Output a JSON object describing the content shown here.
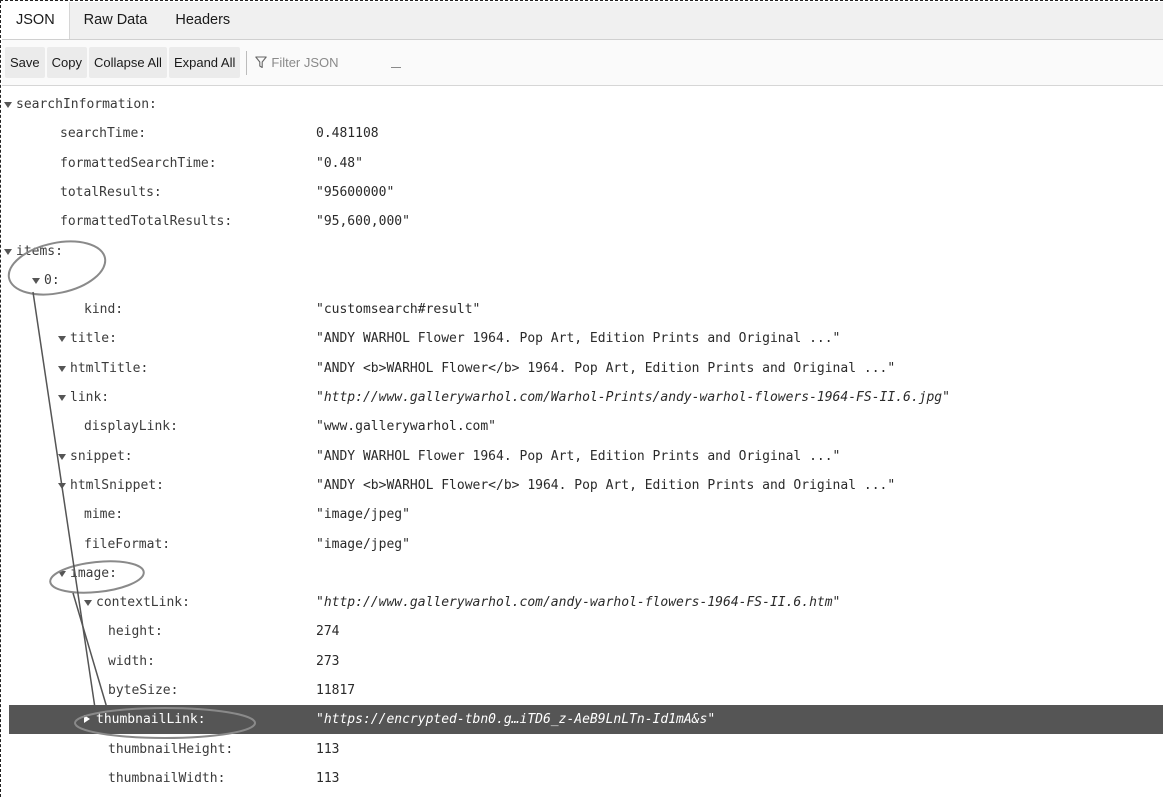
{
  "tabs": [
    "JSON",
    "Raw Data",
    "Headers"
  ],
  "toolbar": {
    "save": "Save",
    "copy": "Copy",
    "collapse_all": "Collapse All",
    "expand_all": "Expand All",
    "filter_placeholder": "Filter JSON",
    "filter_icon": "funnel-icon"
  },
  "tree": [
    {
      "key": "searchInformation:",
      "value": "",
      "depth": 0,
      "expanded": true
    },
    {
      "key": "searchTime:",
      "value": "0.481108",
      "depth": 1
    },
    {
      "key": "formattedSearchTime:",
      "value": "\"0.48\"",
      "depth": 1
    },
    {
      "key": "totalResults:",
      "value": "\"95600000\"",
      "depth": 1
    },
    {
      "key": "formattedTotalResults:",
      "value": "\"95,600,000\"",
      "depth": 1
    },
    {
      "key": "items:",
      "value": "",
      "depth": 0,
      "expanded": true
    },
    {
      "key": "0:",
      "value": "",
      "depth": 1,
      "expanded": true
    },
    {
      "key": "kind:",
      "value": "\"customsearch#result\"",
      "depth": 2
    },
    {
      "key": "title:",
      "value": "\"ANDY WARHOL Flower 1964. Pop Art, Edition Prints and Original ...\"",
      "depth": 2,
      "expanded": true
    },
    {
      "key": "htmlTitle:",
      "value": "\"ANDY <b>WARHOL Flower</b> 1964. Pop Art, Edition Prints and Original ...\"",
      "depth": 2,
      "expanded": true
    },
    {
      "key": "link:",
      "value": "\"http://www.gallerywarhol.com/Warhol-Prints/andy-warhol-flowers-1964-FS-II.6.jpg\"",
      "depth": 2,
      "expanded": true,
      "italic": true
    },
    {
      "key": "displayLink:",
      "value": "\"www.gallerywarhol.com\"",
      "depth": 2
    },
    {
      "key": "snippet:",
      "value": "\"ANDY WARHOL Flower 1964. Pop Art, Edition Prints and Original ...\"",
      "depth": 2,
      "expanded": true
    },
    {
      "key": "htmlSnippet:",
      "value": "\"ANDY <b>WARHOL Flower</b> 1964. Pop Art, Edition Prints and Original ...\"",
      "depth": 2,
      "expanded": true
    },
    {
      "key": "mime:",
      "value": "\"image/jpeg\"",
      "depth": 2
    },
    {
      "key": "fileFormat:",
      "value": "\"image/jpeg\"",
      "depth": 2
    },
    {
      "key": "image:",
      "value": "",
      "depth": 2,
      "expanded": true
    },
    {
      "key": "contextLink:",
      "value": "\"http://www.gallerywarhol.com/andy-warhol-flowers-1964-FS-II.6.htm\"",
      "depth": 3,
      "expanded": true,
      "italic": true
    },
    {
      "key": "height:",
      "value": "274",
      "depth": 3
    },
    {
      "key": "width:",
      "value": "273",
      "depth": 3
    },
    {
      "key": "byteSize:",
      "value": "11817",
      "depth": 3
    },
    {
      "key": "thumbnailLink:",
      "value": "\"https://encrypted-tbn0.g…iTD6_z-AeB9LnLTn-Id1mA&s\"",
      "depth": 3,
      "expanded": false,
      "italic": true,
      "selected": true
    },
    {
      "key": "thumbnailHeight:",
      "value": "113",
      "depth": 3
    },
    {
      "key": "thumbnailWidth:",
      "value": "113",
      "depth": 3
    }
  ]
}
